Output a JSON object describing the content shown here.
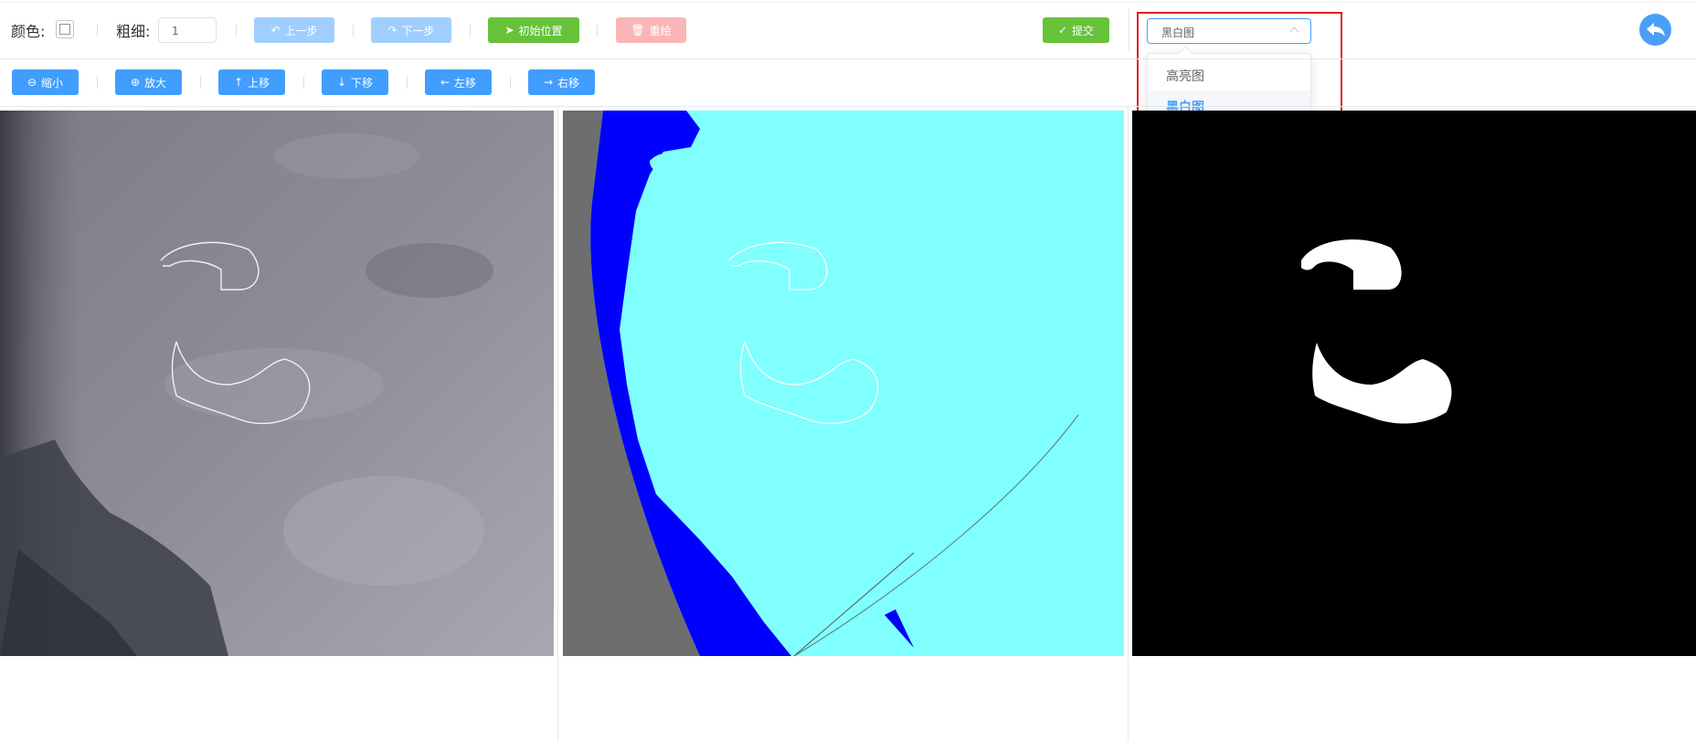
{
  "toolbar": {
    "color_label": "颜色:",
    "width_label": "粗细:",
    "width_value": "1",
    "undo_label": "上一步",
    "redo_label": "下一步",
    "init_label": "初始位置",
    "reset_label": "重绘",
    "submit_label": "提交"
  },
  "view_select": {
    "value": "黑白图",
    "options": [
      "高亮图",
      "黑白图"
    ],
    "selected_index": 1
  },
  "nav": {
    "zoom_out": "缩小",
    "zoom_in": "放大",
    "up": "上移",
    "down": "下移",
    "left": "左移",
    "right": "右移"
  },
  "colors": {
    "primary": "#409eff",
    "success": "#67c23a",
    "danger_disabled": "#fab6b6",
    "mask_cyan": "#80ffff",
    "mask_blue": "#0000ff",
    "mask_gray": "#6e6e6e",
    "highlight_border": "#e02020"
  },
  "icons": {
    "undo": "undo-icon",
    "redo": "redo-icon",
    "init": "navigation-icon",
    "reset": "trash-icon",
    "submit": "check-icon",
    "back": "back-arrow-icon"
  }
}
